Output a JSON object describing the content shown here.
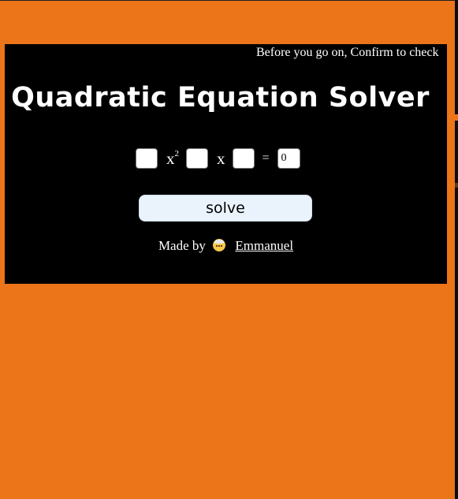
{
  "page": {
    "background_color": "#ec7419",
    "panel_color": "#000000"
  },
  "notice": {
    "text": "Before you go on, Confirm to check"
  },
  "header": {
    "title": "Quadratic Equation Solver"
  },
  "equation": {
    "a_value": "",
    "x_squared_symbol": "x",
    "exponent": "2",
    "b_value": "",
    "x_symbol": "x",
    "c_value": "",
    "equals_sign": "=",
    "rhs_value": "0"
  },
  "actions": {
    "solve_label": "solve"
  },
  "footer": {
    "made_by_label": "Made by",
    "avatar_icon": "older-person-emoji",
    "author_name": "Emmanuel"
  }
}
